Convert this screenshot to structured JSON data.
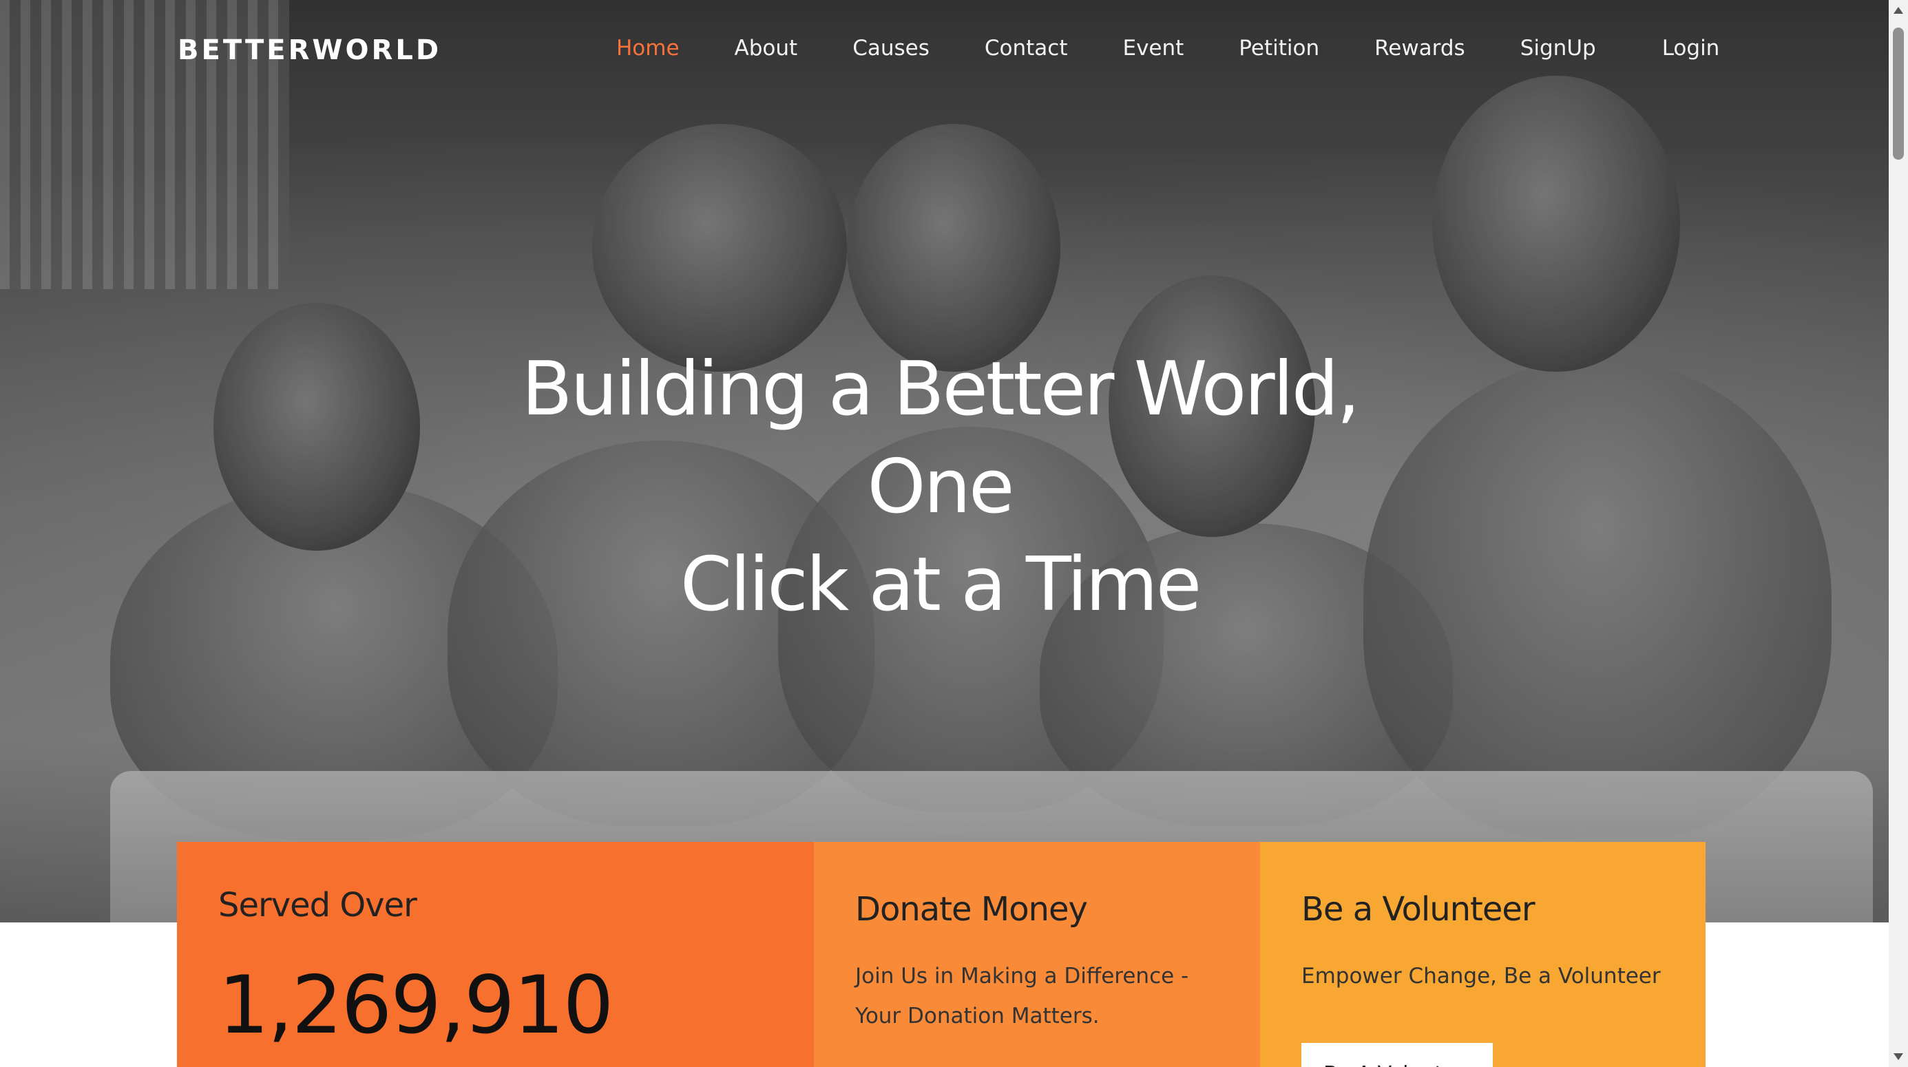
{
  "nav": {
    "brand": "BETTERWORLD",
    "links": [
      {
        "label": "Home",
        "active": true
      },
      {
        "label": "About"
      },
      {
        "label": "Causes"
      },
      {
        "label": "Contact"
      },
      {
        "label": "Event"
      },
      {
        "label": "Petition"
      },
      {
        "label": "Rewards"
      },
      {
        "label": "SignUp"
      },
      {
        "label": "Login"
      }
    ],
    "active_color": "#f7733a"
  },
  "hero": {
    "title_line1": "Building a Better World, One",
    "title_line2": "Click at a Time"
  },
  "cards": {
    "served": {
      "title": "Served Over",
      "count": "1,269,910",
      "color": "#f7702d"
    },
    "donate": {
      "title": "Donate Money",
      "text": "Join Us in Making a Difference - Your Donation Matters.",
      "color": "#f98a38"
    },
    "volunteer": {
      "title": "Be a Volunteer",
      "text": "Empower Change, Be a Volunteer",
      "button_label": "Be A Volunteer",
      "color": "#f8a733"
    }
  }
}
